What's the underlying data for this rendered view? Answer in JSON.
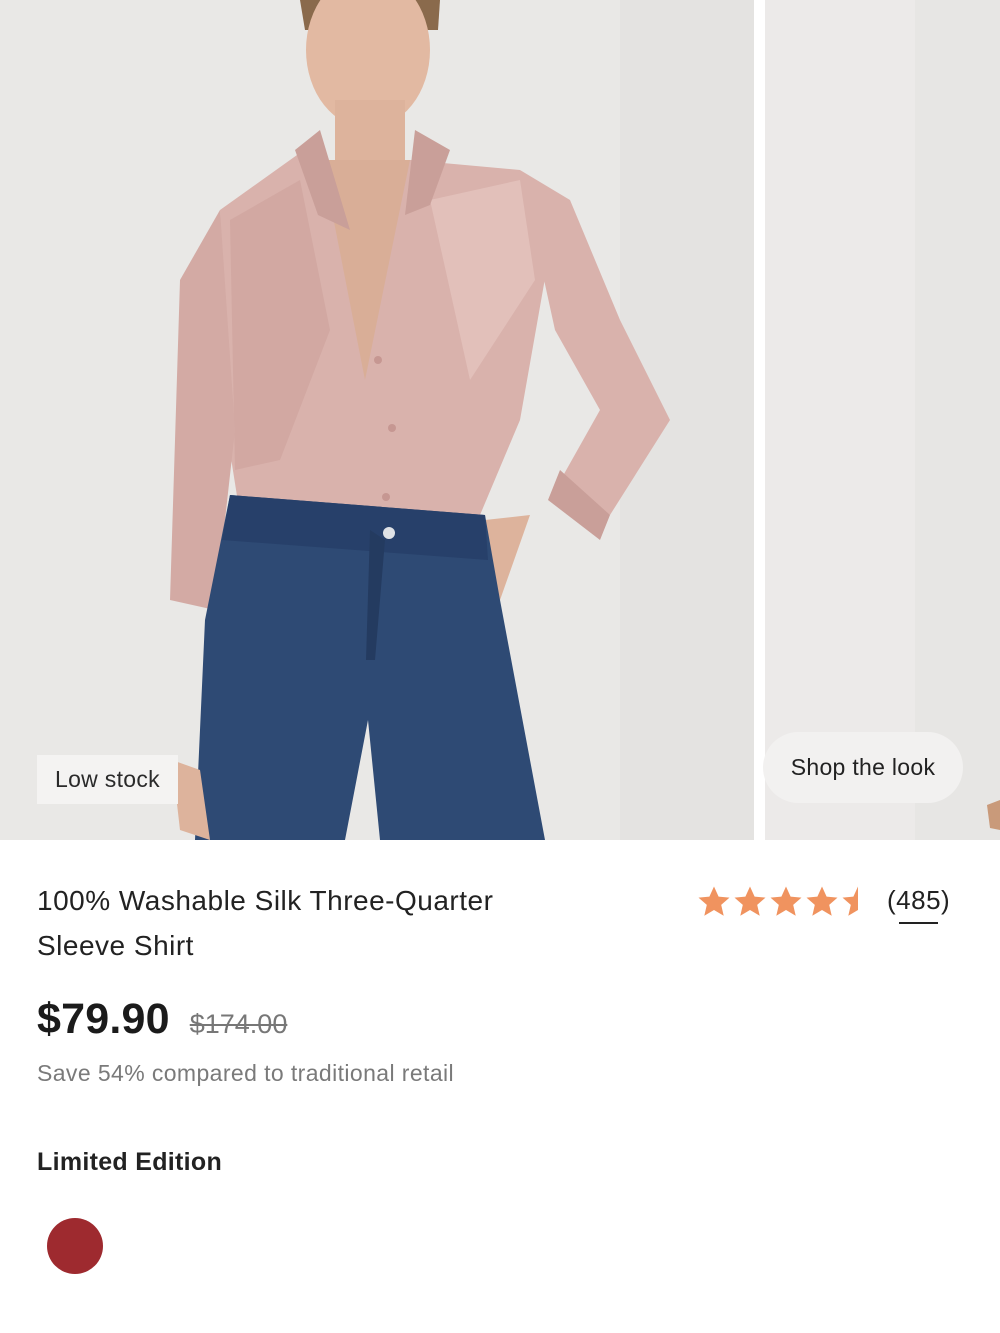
{
  "gallery": {
    "badge": "Low stock",
    "shop_the_look": "Shop the look"
  },
  "product": {
    "title_line1": "100% Washable Silk Three-Quarter",
    "title_line2": "Sleeve Shirt",
    "rating_value": 4.5,
    "rating_max": 5,
    "review_count": "(485)",
    "price": "$79.90",
    "original_price": "$174.00",
    "savings_text": "Save 54% compared to traditional retail",
    "edition_label": "Limited Edition",
    "swatches": [
      {
        "name": "burgundy",
        "color": "#9e2a2f"
      }
    ]
  },
  "colors": {
    "star": "#f0935f",
    "star_empty": "#d8d8d8",
    "shirt": "#d9b2ac",
    "denim": "#2e4a74"
  }
}
